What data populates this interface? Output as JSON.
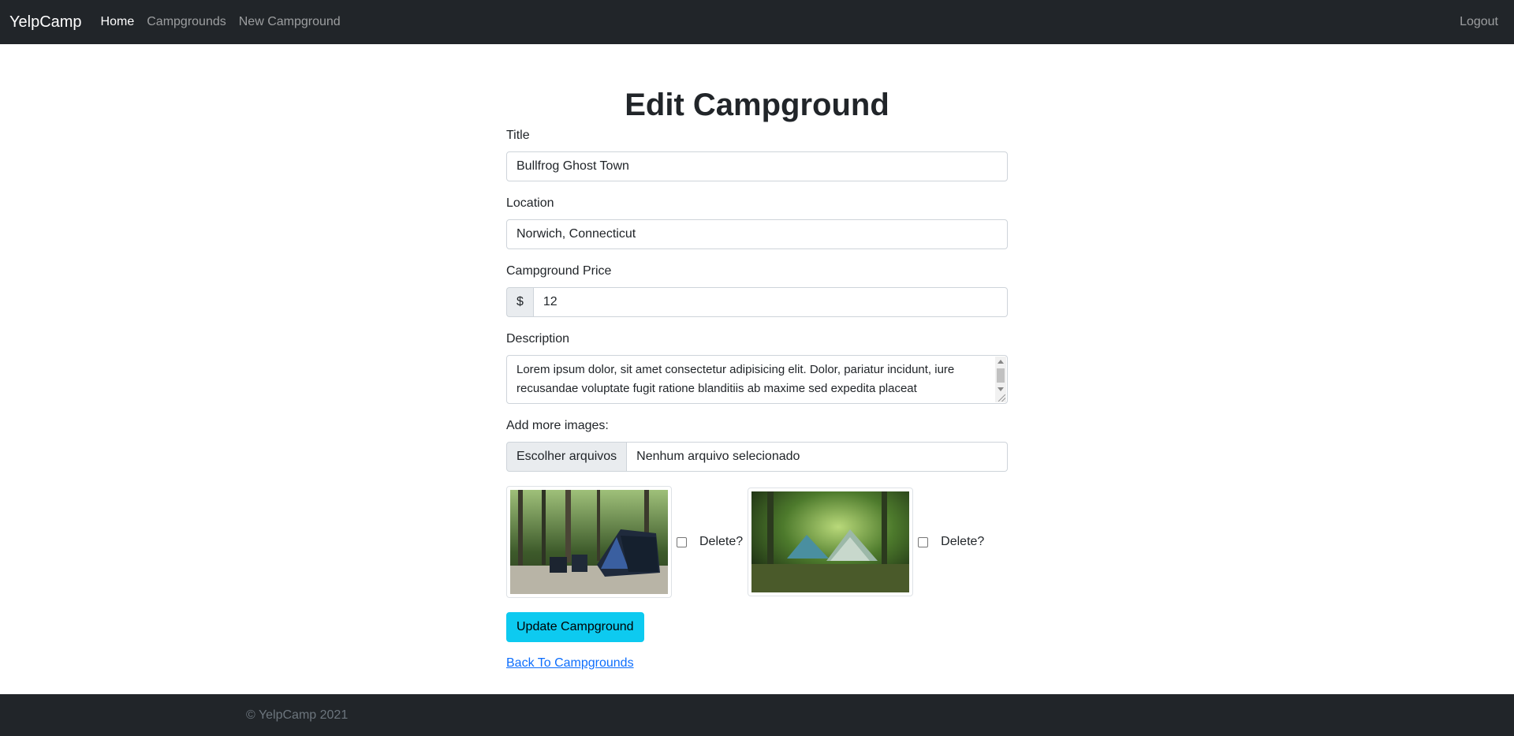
{
  "navbar": {
    "brand": "YelpCamp",
    "links": [
      {
        "label": "Home"
      },
      {
        "label": "Campgrounds"
      },
      {
        "label": "New Campground"
      }
    ],
    "logout": "Logout"
  },
  "form": {
    "page_title": "Edit Campground",
    "title_label": "Title",
    "title_value": "Bullfrog Ghost Town",
    "location_label": "Location",
    "location_value": "Norwich, Connecticut",
    "price_label": "Campground Price",
    "price_prefix": "$",
    "price_value": "12",
    "description_label": "Description",
    "description_value": "Lorem ipsum dolor, sit amet consectetur adipisicing elit. Dolor, pariatur incidunt, iure recusandae voluptate fugit ratione blanditiis ab maxime sed expedita placeat",
    "images_label": "Add more images:",
    "file_button": "Escolher arquivos",
    "file_status": "Nenhum arquivo selecionado",
    "images": [
      {
        "delete_label": "Delete?",
        "checked": false
      },
      {
        "delete_label": "Delete?",
        "checked": false
      }
    ],
    "submit_label": "Update Campground",
    "back_link": "Back To Campgrounds"
  },
  "footer": {
    "text": "© YelpCamp 2021"
  },
  "colors": {
    "navbar_bg": "#212529",
    "accent_button": "#0dcaf0",
    "link": "#0d6efd"
  }
}
